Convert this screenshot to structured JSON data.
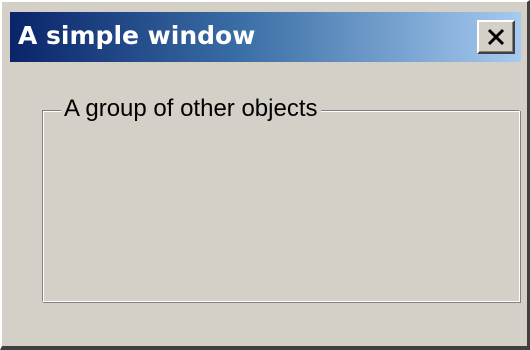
{
  "window": {
    "title": "A simple window",
    "close_icon": "close-x-icon"
  },
  "groupbox": {
    "label": "A group of other objects"
  },
  "colors": {
    "titlebar_start": "#0a246a",
    "titlebar_end": "#a6caf0",
    "window_face": "#d4d0c8",
    "title_text": "#ffffff"
  }
}
